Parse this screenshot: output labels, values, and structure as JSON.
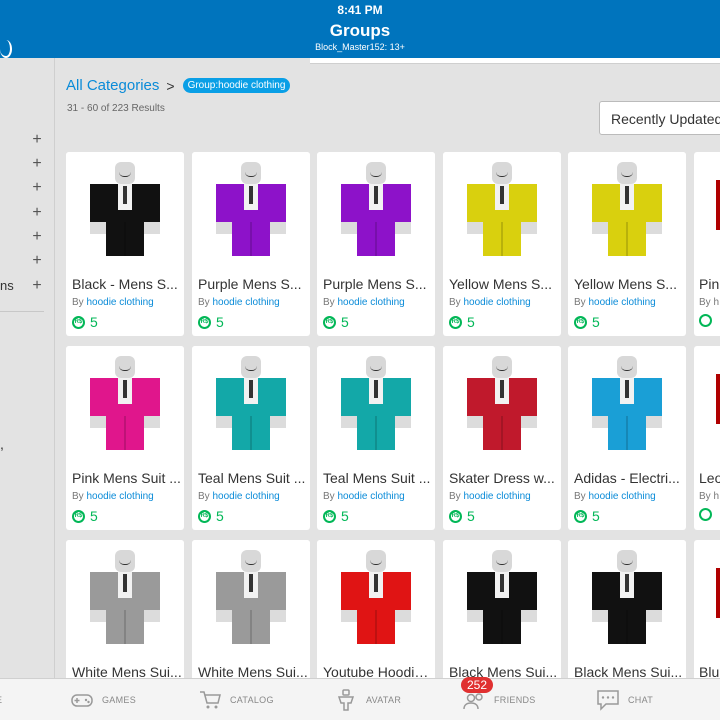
{
  "status_bar": {
    "time": "8:41 PM"
  },
  "header": {
    "title": "Groups",
    "subtitle": "Block_Master152: 13+"
  },
  "sidebar": {
    "partial_label": "ns",
    "partial_comma": ","
  },
  "breadcrumb": {
    "all_categories": "All Categories",
    "chevron": ">",
    "filter_tag": "Group:hoodie clothing"
  },
  "results": {
    "text": "31 - 60 of 223 Results"
  },
  "sort": {
    "selected": "Recently Updated"
  },
  "robux_symbol": "R$",
  "items": [
    {
      "name": "Black - Mens S...",
      "by": "By",
      "creator": "hoodie clothing",
      "price": "5",
      "color": "#111111"
    },
    {
      "name": "Purple Mens S...",
      "by": "By",
      "creator": "hoodie clothing",
      "price": "5",
      "color": "#8d12c9"
    },
    {
      "name": "Purple Mens S...",
      "by": "By",
      "creator": "hoodie clothing",
      "price": "5",
      "color": "#8d12c9"
    },
    {
      "name": "Yellow Mens S...",
      "by": "By",
      "creator": "hoodie clothing",
      "price": "5",
      "color": "#d9d00e"
    },
    {
      "name": "Yellow Mens S...",
      "by": "By",
      "creator": "hoodie clothing",
      "price": "5",
      "color": "#d9d00e"
    },
    {
      "name": "Pink Mens Suit ...",
      "by": "By",
      "creator": "hoodie clothing",
      "price": "5",
      "color": "#e0168c"
    },
    {
      "name": "Teal Mens Suit ...",
      "by": "By",
      "creator": "hoodie clothing",
      "price": "5",
      "color": "#13a8a8"
    },
    {
      "name": "Teal Mens Suit ...",
      "by": "By",
      "creator": "hoodie clothing",
      "price": "5",
      "color": "#13a8a8"
    },
    {
      "name": "Skater Dress w...",
      "by": "By",
      "creator": "hoodie clothing",
      "price": "5",
      "color": "#c0192c"
    },
    {
      "name": "Adidas - Electri...",
      "by": "By",
      "creator": "hoodie clothing",
      "price": "5",
      "color": "#1a9fd6"
    },
    {
      "name": "White Mens Sui...",
      "by": "By",
      "creator": "hoodie clothing",
      "price": "5",
      "color": "#9a9a9a"
    },
    {
      "name": "White Mens Sui...",
      "by": "By",
      "creator": "hoodie clothing",
      "price": "5",
      "color": "#9a9a9a"
    },
    {
      "name": "Youtube Hoodie...",
      "by": "By",
      "creator": "hoodie clothing",
      "price": "5",
      "color": "#e01414"
    },
    {
      "name": "Black Mens Sui...",
      "by": "By",
      "creator": "hoodie clothing",
      "price": "5",
      "color": "#111111"
    },
    {
      "name": "Black Mens Sui...",
      "by": "By",
      "creator": "hoodie clothing",
      "price": "5",
      "color": "#111111"
    }
  ],
  "partial_items": [
    {
      "name": "Pin",
      "by": "By h"
    },
    {
      "name": "Leo",
      "by": "By h"
    },
    {
      "name": "Blu",
      "by": ""
    }
  ],
  "bottom_nav": {
    "items": [
      {
        "label": "E",
        "icon": "home-icon"
      },
      {
        "label": "GAMES",
        "icon": "gamepad-icon"
      },
      {
        "label": "CATALOG",
        "icon": "cart-icon"
      },
      {
        "label": "AVATAR",
        "icon": "avatar-icon"
      },
      {
        "label": "FRIENDS",
        "icon": "friends-icon"
      },
      {
        "label": "CHAT",
        "icon": "chat-icon"
      }
    ],
    "friends_badge": "252"
  }
}
